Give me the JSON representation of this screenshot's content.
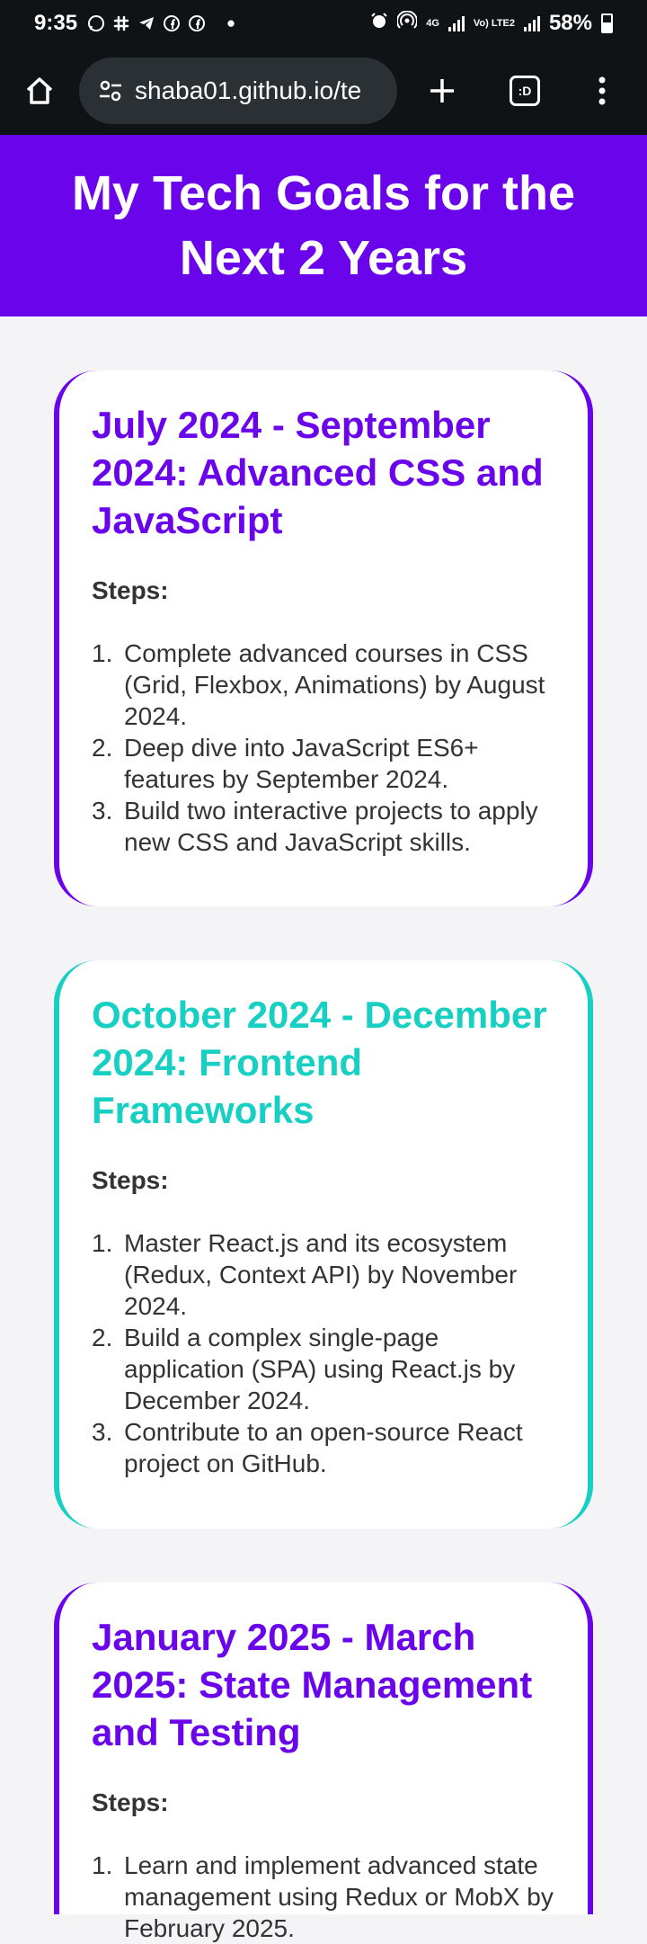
{
  "status_bar": {
    "time": "9:35",
    "battery": "58%",
    "network_labels": [
      "4G",
      "Vo) LTE2"
    ]
  },
  "browser": {
    "url": "shaba01.github.io/te",
    "tabs_label": ":D"
  },
  "page": {
    "title": "My Tech Goals for the Next 2 Years",
    "goals": [
      {
        "heading": "July 2024 - September 2024: Advanced CSS and JavaScript",
        "accent": "#6a04ea",
        "steps_label": "Steps:",
        "steps": [
          {
            "num": "1.",
            "text": "Complete advanced courses in CSS (Grid, Flexbox, Animations) by August 2024."
          },
          {
            "num": "2.",
            "text": "Deep dive into JavaScript ES6+ features by September 2024."
          },
          {
            "num": "3.",
            "text": "Build two interactive projects to apply new CSS and JavaScript skills."
          }
        ]
      },
      {
        "heading": "October 2024 - December 2024: Frontend Frameworks",
        "accent": "#17cfc2",
        "steps_label": "Steps:",
        "steps": [
          {
            "num": "1.",
            "text": "Master React.js and its ecosystem (Redux, Context API) by November 2024."
          },
          {
            "num": "2.",
            "text": "Build a complex single-page application (SPA) using React.js by December 2024."
          },
          {
            "num": "3.",
            "text": "Contribute to an open-source React project on GitHub."
          }
        ]
      },
      {
        "heading": "January 2025 - March 2025: State Management and Testing",
        "accent": "#6a04ea",
        "steps_label": "Steps:",
        "steps": [
          {
            "num": "1.",
            "text": "Learn and implement advanced state management using Redux or MobX by February 2025."
          }
        ]
      }
    ]
  }
}
